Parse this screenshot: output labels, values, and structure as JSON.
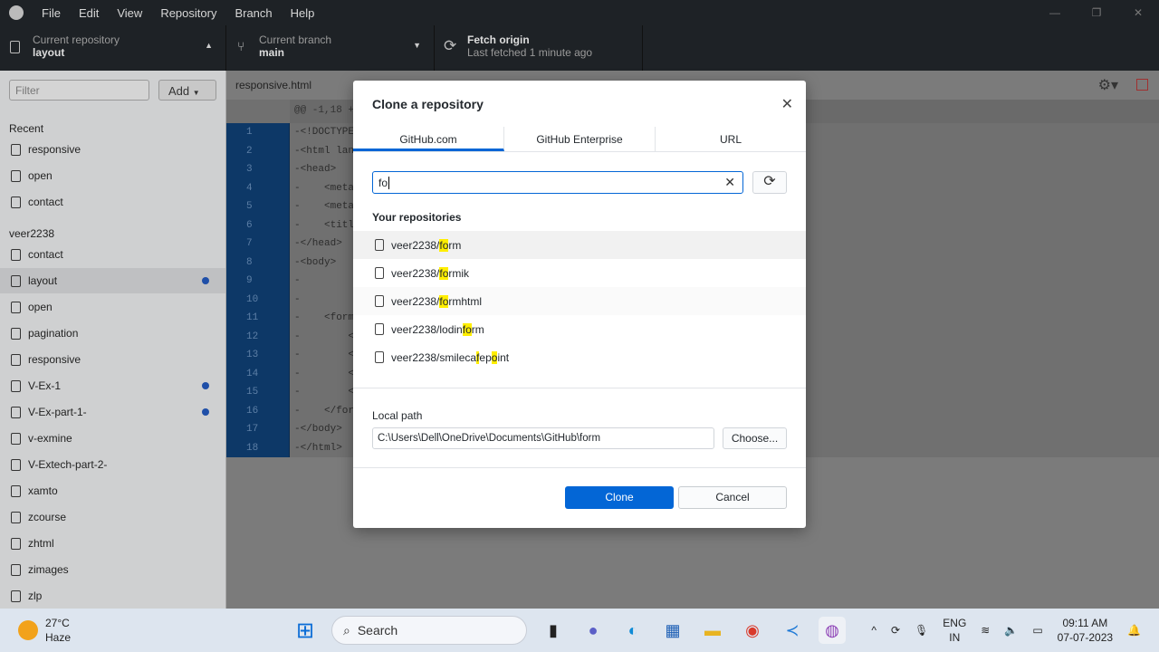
{
  "menu": [
    "File",
    "Edit",
    "View",
    "Repository",
    "Branch",
    "Help"
  ],
  "toolbar": {
    "repo_label": "Current repository",
    "repo_value": "layout",
    "branch_label": "Current branch",
    "branch_value": "main",
    "fetch_label": "Fetch origin",
    "fetch_sub": "Last fetched 1 minute ago"
  },
  "sidebar": {
    "filter_placeholder": "Filter",
    "add_label": "Add",
    "recent_heading": "Recent",
    "recent": [
      "responsive",
      "open",
      "contact"
    ],
    "owner_heading": "veer2238",
    "repos": [
      {
        "name": "contact",
        "dot": false
      },
      {
        "name": "layout",
        "dot": true,
        "selected": true
      },
      {
        "name": "open",
        "dot": false
      },
      {
        "name": "pagination",
        "dot": false
      },
      {
        "name": "responsive",
        "dot": false
      },
      {
        "name": "V-Ex-1",
        "dot": true
      },
      {
        "name": "V-Ex-part-1-",
        "dot": true
      },
      {
        "name": "v-exmine",
        "dot": false
      },
      {
        "name": "V-Extech-part-2-",
        "dot": false
      },
      {
        "name": "xamto",
        "dot": false
      },
      {
        "name": "zcourse",
        "dot": false
      },
      {
        "name": "zhtml",
        "dot": false
      },
      {
        "name": "zimages",
        "dot": false
      },
      {
        "name": "zlp",
        "dot": false
      }
    ]
  },
  "diff": {
    "file": "responsive.html",
    "hunk": "@@ -1,18 +0",
    "lines": [
      "-<!DOCTYPE",
      "-<html lang",
      "-<head>",
      "-    <meta",
      "-    <meta",
      "-    <title",
      "-</head>",
      "-<body>",
      "-",
      "-",
      "-    <form>",
      "-        <i",
      "-        <i",
      "-        <i",
      "-        <i",
      "-    </form",
      "-</body>",
      "-</html>"
    ]
  },
  "dialog": {
    "title": "Clone a repository",
    "tabs": [
      "GitHub.com",
      "GitHub Enterprise",
      "URL"
    ],
    "active_tab": "GitHub.com",
    "search_value": "fo",
    "section": "Your repositories",
    "repos": [
      {
        "pre": "veer2238/",
        "m1": "fo",
        "mid": "rm",
        "m2": "",
        "post": ""
      },
      {
        "pre": "veer2238/",
        "m1": "fo",
        "mid": "rmik",
        "m2": "",
        "post": ""
      },
      {
        "pre": "veer2238/",
        "m1": "fo",
        "mid": "rmhtml",
        "m2": "",
        "post": ""
      },
      {
        "pre": "veer2238/lodin",
        "m1": "fo",
        "mid": "rm",
        "m2": "",
        "post": ""
      },
      {
        "pre": "veer2238/smileca",
        "m1": "f",
        "mid": "ep",
        "m2": "o",
        "post": "int"
      }
    ],
    "local_path_label": "Local path",
    "local_path": "C:\\Users\\Dell\\OneDrive\\Documents\\GitHub\\form",
    "choose_label": "Choose...",
    "clone_label": "Clone",
    "cancel_label": "Cancel",
    "accent": "#0366d6"
  },
  "taskbar": {
    "temp": "27°C",
    "weather": "Haze",
    "search": "Search",
    "lang1": "ENG",
    "lang2": "IN",
    "time": "09:11 AM",
    "date": "07-07-2023"
  }
}
